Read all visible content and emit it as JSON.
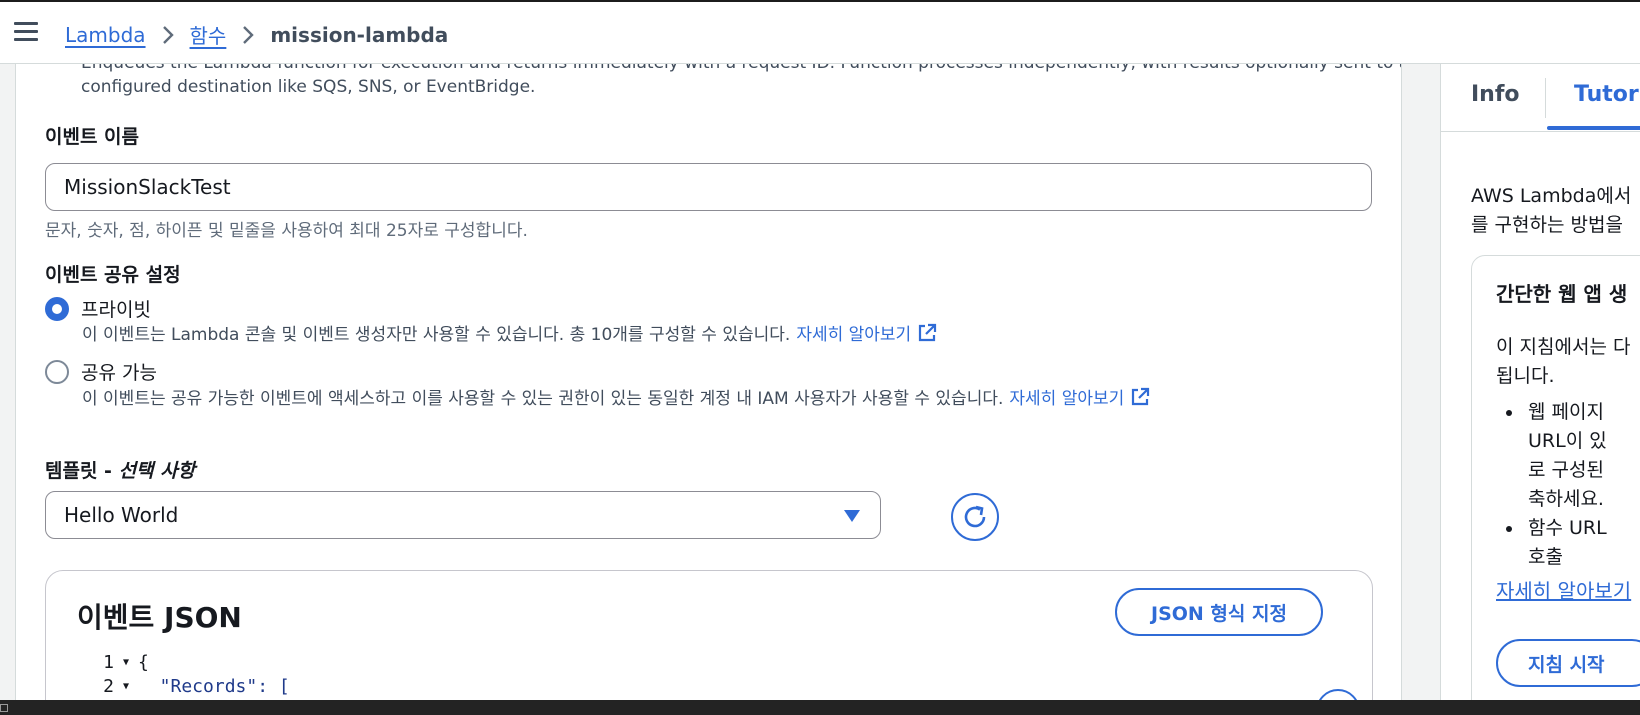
{
  "breadcrumb": {
    "items": [
      "Lambda",
      "함수"
    ],
    "current": "mission-lambda"
  },
  "form": {
    "async_description": "Enqueues the Lambda function for execution and returns immediately with a request ID. Function processes independently, with results optionally sent to a",
    "async_description_line2": "configured destination like SQS, SNS, or EventBridge.",
    "event_name_label": "이벤트 이름",
    "event_name_value": "MissionSlackTest",
    "event_name_hint": "문자, 숫자, 점, 하이픈 및 밑줄을 사용하여 최대 25자로 구성합니다.",
    "sharing_label": "이벤트 공유 설정",
    "private_label": "프라이빗",
    "private_desc": "이 이벤트는 Lambda 콘솔 및 이벤트 생성자만 사용할 수 있습니다. 총 10개를 구성할 수 있습니다.",
    "shareable_label": "공유 가능",
    "shareable_desc": "이 이벤트는 공유 가능한 이벤트에 액세스하고 이를 사용할 수 있는 권한이 있는 동일한 계정 내 IAM 사용자가 사용할 수 있습니다.",
    "learn_more": "자세히 알아보기",
    "template_label": "템플릿 - ",
    "template_optional": "선택 사항",
    "template_value": "Hello World",
    "selected_sharing": "private"
  },
  "json_editor": {
    "title": "이벤트 JSON",
    "format_button": "JSON 형식 지정",
    "lines": [
      {
        "num": "1",
        "fold": "▼",
        "text": "{"
      },
      {
        "num": "2",
        "fold": "▼",
        "text": "  \"Records\": ["
      }
    ]
  },
  "help_panel": {
    "tab_info": "Info",
    "tab_tutorials": "Tutorials",
    "intro_line1": "AWS Lambda에서",
    "intro_line2": "를 구현하는 방법을",
    "card_title": "간단한 웹 앱 생",
    "card_body_line1": "이 지침에서는 다",
    "card_body_line2": "됩니다.",
    "bullet1_lines": [
      "웹 페이지",
      "URL이 있",
      "로 구성된",
      "축하세요."
    ],
    "bullet2_lines": [
      "함수 URL",
      "호출"
    ],
    "learn_more": "자세히 알아보기",
    "start_button": "지침 시작"
  },
  "colors": {
    "accent": "#2f6bd6",
    "text": "#16191f",
    "secondary_text": "#5f6b7a",
    "border": "#8c8c94"
  }
}
